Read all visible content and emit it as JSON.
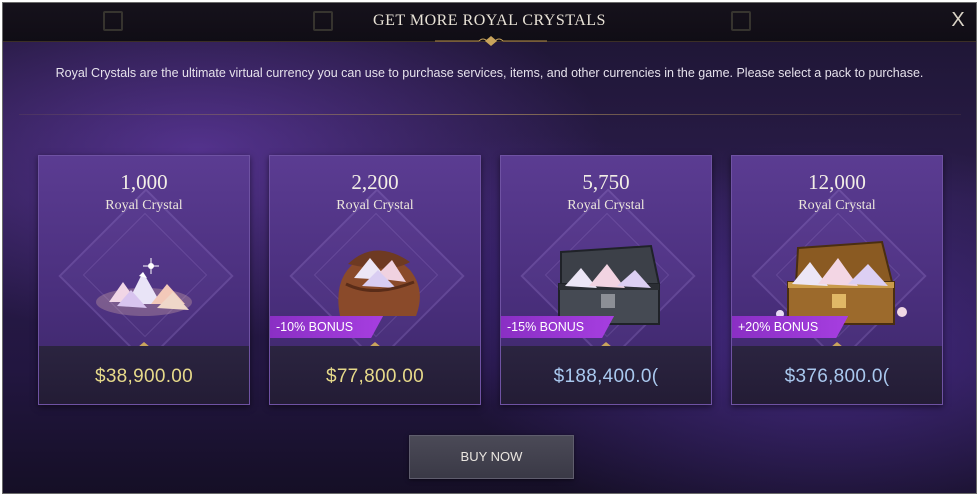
{
  "dialog": {
    "title": "GET MORE ROYAL CRYSTALS",
    "close_glyph": "X",
    "description": "Royal Crystals are the ultimate virtual currency you can use to purchase services, items, and other currencies in the game. Please select a pack to purchase."
  },
  "packs": [
    {
      "quantity": "1,000",
      "unit": "Royal Crystal",
      "bonus": "",
      "price": "$38,900.00",
      "price_color": "#e6d98a",
      "art": "crystal-pile-icon"
    },
    {
      "quantity": "2,200",
      "unit": "Royal Crystal",
      "bonus": "-10% BONUS",
      "price": "$77,800.00",
      "price_color": "#e6d98a",
      "art": "crystal-bag-icon"
    },
    {
      "quantity": "5,750",
      "unit": "Royal Crystal",
      "bonus": "-15% BONUS",
      "price": "$188,400.0(",
      "price_color": "#a9c8ee",
      "art": "iron-chest-icon"
    },
    {
      "quantity": "12,000",
      "unit": "Royal Crystal",
      "bonus": "+20% BONUS",
      "price": "$376,800.0(",
      "price_color": "#a9c8ee",
      "art": "gold-chest-icon"
    }
  ],
  "buy_button": {
    "label": "BUY NOW"
  },
  "colors": {
    "bonus_ribbon": "#a63ee0",
    "card_bg": "#4a2f7d",
    "accent_gold": "#c9a45c"
  }
}
